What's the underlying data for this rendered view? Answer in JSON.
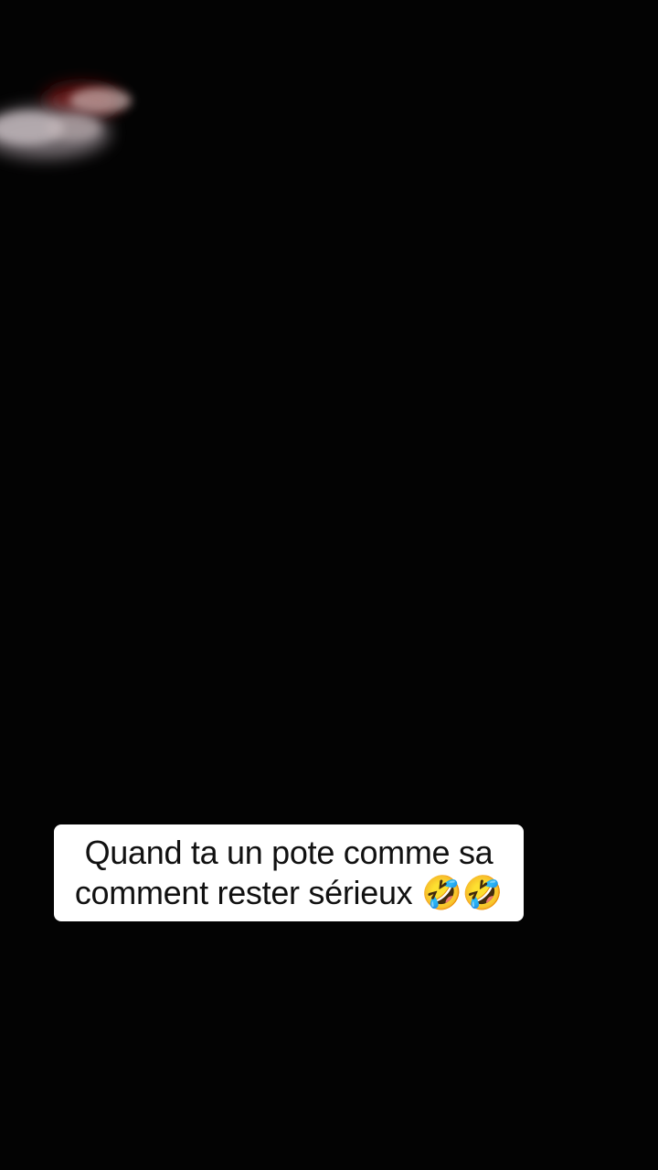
{
  "video": {
    "background_color": "#000000"
  },
  "caption": {
    "line1": "Quand ta un pote comme sa",
    "line2": "comment rester sérieux 🤣🤣",
    "background_color": "#ffffff",
    "text_color": "#111111"
  }
}
